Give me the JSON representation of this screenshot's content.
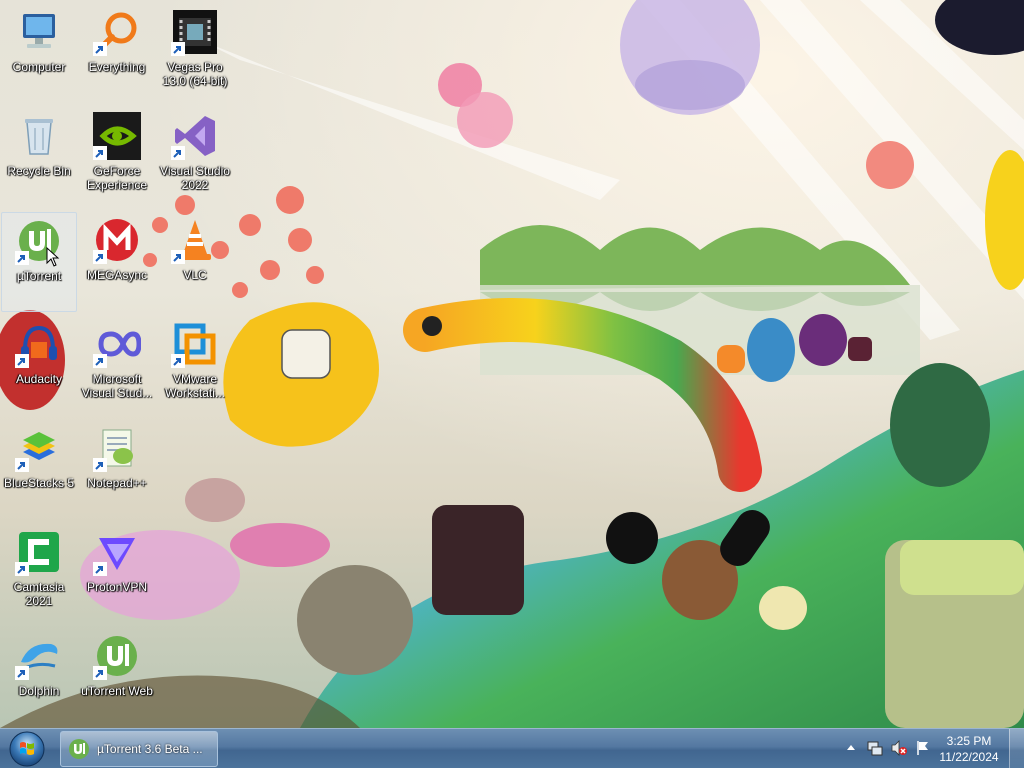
{
  "desktop": {
    "wallpaper": "illustrated-creatures-wallpaper",
    "icons": [
      {
        "id": "computer",
        "label": "Computer",
        "icon": "computer-icon",
        "shortcut": false,
        "selected": false
      },
      {
        "id": "everything",
        "label": "Everything",
        "icon": "everything-search-icon",
        "shortcut": true,
        "selected": false
      },
      {
        "id": "vegas",
        "label": "Vegas Pro 13.0 (64-bit)",
        "icon": "vegas-pro-icon",
        "shortcut": true,
        "selected": false
      },
      {
        "id": "recycle",
        "label": "Recycle Bin",
        "icon": "recycle-bin-icon",
        "shortcut": false,
        "selected": false
      },
      {
        "id": "geforce",
        "label": "GeForce Experience",
        "icon": "geforce-experience-icon",
        "shortcut": true,
        "selected": false
      },
      {
        "id": "vstudio",
        "label": "Visual Studio 2022",
        "icon": "visual-studio-icon",
        "shortcut": true,
        "selected": false
      },
      {
        "id": "utorrent",
        "label": "µTorrent",
        "icon": "utorrent-icon",
        "shortcut": true,
        "selected": true
      },
      {
        "id": "megasync",
        "label": "MEGAsync",
        "icon": "megasync-icon",
        "shortcut": true,
        "selected": false
      },
      {
        "id": "vlc",
        "label": "VLC",
        "icon": "vlc-icon",
        "shortcut": true,
        "selected": false
      },
      {
        "id": "audacity",
        "label": "Audacity",
        "icon": "audacity-icon",
        "shortcut": true,
        "selected": false
      },
      {
        "id": "msvisual",
        "label": "Microsoft Visual Stud...",
        "icon": "visual-studio-installer-icon",
        "shortcut": true,
        "selected": false
      },
      {
        "id": "vmware",
        "label": "VMware Workstati...",
        "icon": "vmware-icon",
        "shortcut": true,
        "selected": false
      },
      {
        "id": "bluestacks",
        "label": "BlueStacks 5",
        "icon": "bluestacks-icon",
        "shortcut": true,
        "selected": false
      },
      {
        "id": "notepadpp",
        "label": "Notepad++",
        "icon": "notepad-plus-plus-icon",
        "shortcut": true,
        "selected": false
      },
      {
        "id": "camtasia",
        "label": "Camtasia 2021",
        "icon": "camtasia-icon",
        "shortcut": true,
        "selected": false
      },
      {
        "id": "protonvpn",
        "label": "ProtonVPN",
        "icon": "protonvpn-icon",
        "shortcut": true,
        "selected": false
      },
      {
        "id": "dolphin",
        "label": "Dolphin",
        "icon": "dolphin-icon",
        "shortcut": true,
        "selected": false
      },
      {
        "id": "utorrentweb",
        "label": "uTorrent Web",
        "icon": "utorrent-web-icon",
        "shortcut": true,
        "selected": false
      }
    ]
  },
  "taskbar": {
    "start_icon": "windows-start-orb-icon",
    "running_app": {
      "label": "µTorrent 3.6 Beta ...",
      "icon": "utorrent-icon"
    },
    "tray": {
      "icons": [
        "show-hidden-icons-arrow",
        "network-icon",
        "volume-muted-icon",
        "action-center-flag-icon"
      ],
      "time": "3:25 PM",
      "date": "11/22/2024"
    }
  }
}
